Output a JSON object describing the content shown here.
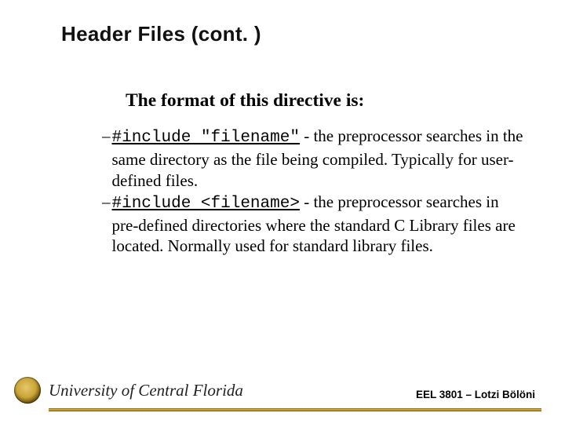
{
  "title": "Header Files (cont. )",
  "subtitle": "The format of this directive is:",
  "bullets": [
    {
      "dash": "–",
      "code": "#include \"filename\"",
      "rest": " - the preprocessor searches in the same directory  as the file being compiled.  Typically for user-defined files."
    },
    {
      "dash": "–",
      "code": "#include <filename>",
      "rest": " - the preprocessor searches in pre-defined directories where the standard C Library files are located.  Normally used for standard library files."
    }
  ],
  "footer": {
    "university": "University of Central Florida",
    "course": "EEL 3801 – Lotzi Bölöni"
  }
}
